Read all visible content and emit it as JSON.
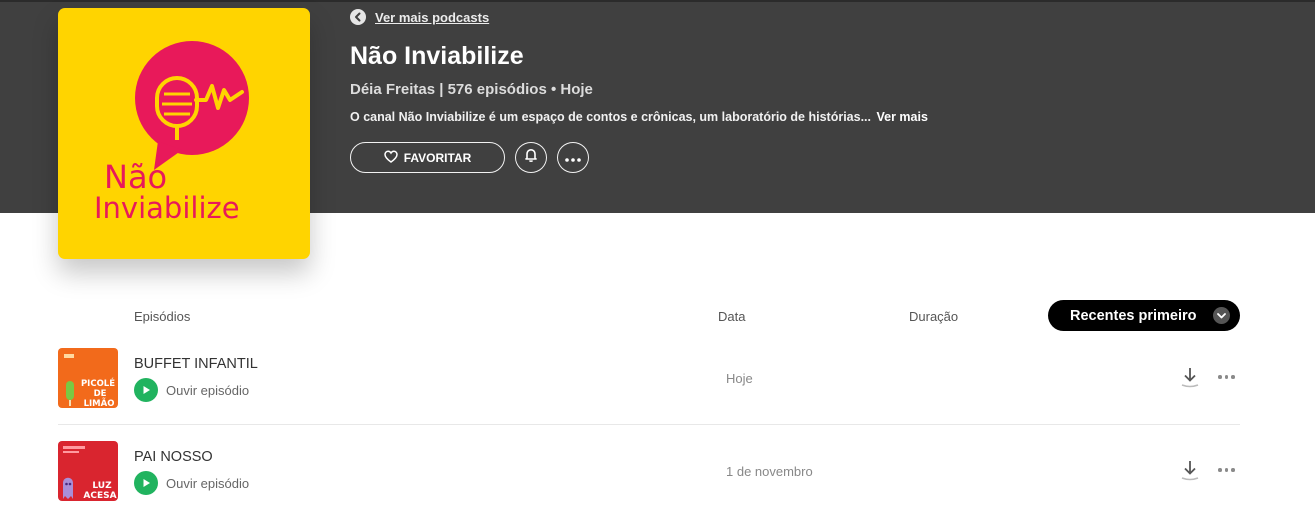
{
  "nav": {
    "back_label": "Ver mais podcasts"
  },
  "podcast": {
    "title": "Não Inviabilize",
    "meta": "Déia Freitas | 576 episódios • Hoje",
    "description": "O canal Não Inviabilize é um espaço de contos e crônicas, um laboratório de histórias...",
    "description_more": "Ver mais",
    "cover": {
      "line1": "Não",
      "line2": "Inviabilize",
      "bg_color": "#ffd400",
      "accent_color": "#e8195a"
    }
  },
  "actions": {
    "favorite_label": "FAVORITAR",
    "notify_icon": "bell-icon",
    "more_icon": "more-horizontal-icon"
  },
  "columns": {
    "episodes": "Episódios",
    "date": "Data",
    "duration": "Duração"
  },
  "sort": {
    "selected": "Recentes primeiro"
  },
  "episodes": [
    {
      "title": "BUFFET INFANTIL",
      "play_label": "Ouvir episódio",
      "date": "Hoje",
      "thumb_text": "PICOLÉ DE LIMÃO",
      "thumb_color": "#f26a1b"
    },
    {
      "title": "PAI NOSSO",
      "play_label": "Ouvir episódio",
      "date": "1 de novembro",
      "thumb_text": "LUZ ACESA",
      "thumb_color": "#d9252f"
    }
  ]
}
